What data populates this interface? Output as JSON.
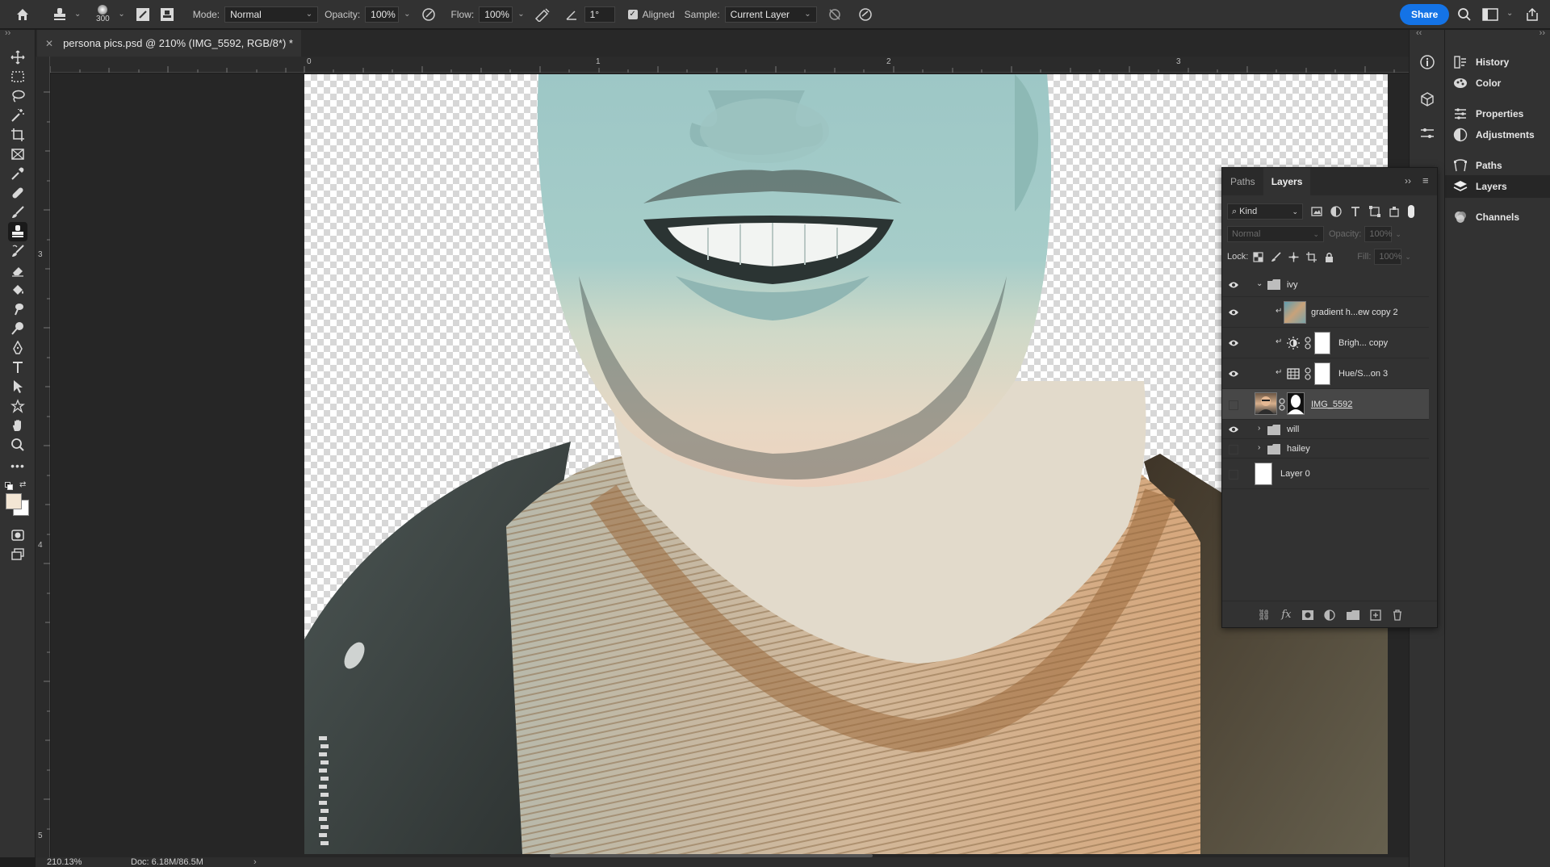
{
  "options_bar": {
    "brush_size": "300",
    "mode_label": "Mode:",
    "mode_value": "Normal",
    "opacity_label": "Opacity:",
    "opacity_value": "100%",
    "flow_label": "Flow:",
    "flow_value": "100%",
    "angle_value": "1°",
    "aligned_label": "Aligned",
    "aligned_checked": true,
    "sample_label": "Sample:",
    "sample_value": "Current Layer",
    "share_label": "Share"
  },
  "document_tab": {
    "title": "persona pics.psd @ 210% (IMG_5592, RGB/8*) *"
  },
  "rulers": {
    "top_ticks": [
      "0",
      "1",
      "2",
      "3"
    ],
    "left_ticks": [
      "3",
      "4",
      "5"
    ]
  },
  "status_bar": {
    "zoom": "210.13%",
    "doc_size": "Doc: 6.18M/86.5M"
  },
  "dock": {
    "items": [
      {
        "label": "History",
        "icon": "history-icon"
      },
      {
        "label": "Color",
        "icon": "color-icon"
      },
      {
        "label": "Properties",
        "icon": "properties-icon"
      },
      {
        "label": "Adjustments",
        "icon": "adjustments-icon"
      },
      {
        "label": "Paths",
        "icon": "paths-icon"
      },
      {
        "label": "Layers",
        "icon": "layers-icon"
      },
      {
        "label": "Channels",
        "icon": "channels-icon"
      }
    ]
  },
  "layers_panel": {
    "tabs": [
      "Paths",
      "Layers"
    ],
    "active_tab": "Layers",
    "filter_label": "Kind",
    "blend_mode": "Normal",
    "opacity_label": "Opacity:",
    "opacity_value": "100%",
    "lock_label": "Lock:",
    "fill_label": "Fill:",
    "fill_value": "100%",
    "layers": [
      {
        "name": "ivy",
        "type": "group",
        "expanded": true,
        "visible": true
      },
      {
        "name": "gradient h...ew copy 2",
        "type": "gradient-adjustment",
        "visible": true,
        "clipped": true
      },
      {
        "name": "Brigh... copy",
        "type": "brightness-adjustment",
        "visible": true,
        "clipped": true
      },
      {
        "name": "Hue/S...on 3",
        "type": "hue-saturation-adjustment",
        "visible": true,
        "clipped": true
      },
      {
        "name": "IMG_5592",
        "type": "image",
        "visible": false,
        "selected": true
      },
      {
        "name": "will",
        "type": "group",
        "expanded": false,
        "visible": true
      },
      {
        "name": "hailey",
        "type": "group",
        "expanded": false,
        "visible": false
      },
      {
        "name": "Layer 0",
        "type": "pixel",
        "visible": false
      }
    ]
  },
  "colors": {
    "accent": "#1473e6",
    "panel_bg": "#323232",
    "canvas_bg": "#262626",
    "foreground_swatch": "#f3e6d4",
    "background_swatch": "#ffffff"
  }
}
